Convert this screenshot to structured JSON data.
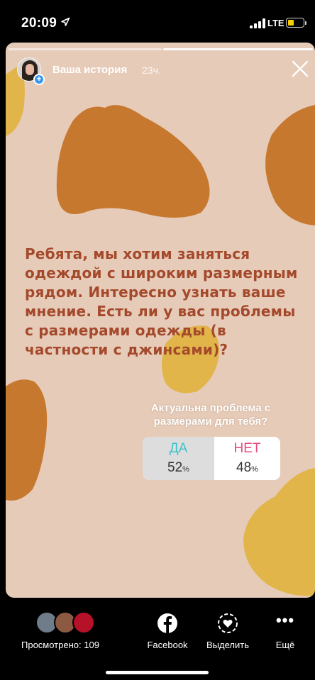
{
  "status_bar": {
    "time": "20:09",
    "network": "LTE",
    "battery_color": "#f5cd00"
  },
  "story": {
    "owner_label": "Ваша история",
    "age": "23ч.",
    "background_color": "#e6cbb8",
    "blob_colors": [
      "#c7782f",
      "#e1b54a"
    ],
    "question": "Ребята, мы хотим заняться одеждой с широким размерным рядом. Интересно узнать ваше мнение. Есть ли у вас проблемы с размерами одежды (в частности с джинсами)?",
    "question_color": "#a4492b",
    "close_icon": "close-icon",
    "progress": {
      "segments": 2,
      "active": 2
    }
  },
  "poll": {
    "title": "Актуальна проблема с размерами для тебя?",
    "options": [
      {
        "label": "ДА",
        "percent": "52",
        "color": "#3fc2c8"
      },
      {
        "label": "НЕТ",
        "percent": "48",
        "color": "#e84a83"
      }
    ],
    "percent_unit": "%"
  },
  "footer": {
    "viewers_label": "Просмотрено: 109",
    "actions": [
      {
        "icon": "facebook-icon",
        "label": "Facebook"
      },
      {
        "icon": "heart-highlight-icon",
        "label": "Выделить"
      },
      {
        "icon": "more-icon",
        "label": "Ещё"
      }
    ]
  }
}
